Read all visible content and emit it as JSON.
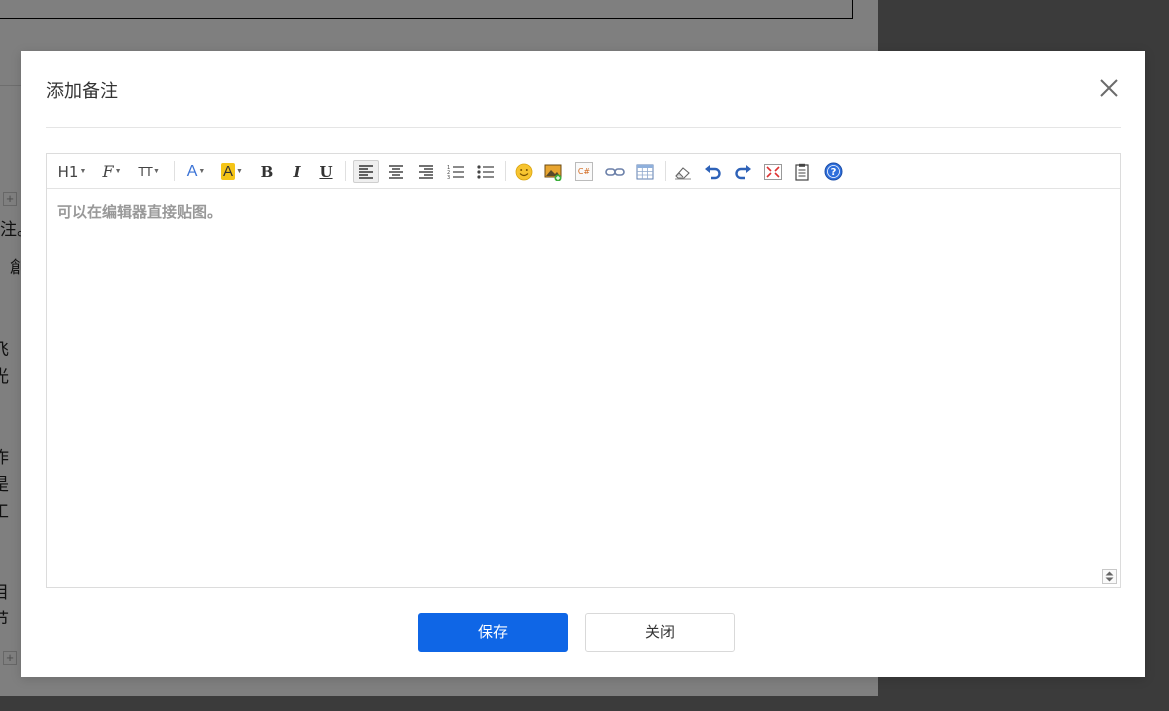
{
  "background": {
    "fragments": [
      "注。",
      "創",
      "飞",
      "光",
      "作",
      "是",
      "工",
      "目",
      "节"
    ]
  },
  "modal": {
    "title": "添加备注",
    "close_icon": "close-icon"
  },
  "editor": {
    "placeholder": "可以在编辑器直接贴图。",
    "toolbar": {
      "heading": "H1",
      "font_family": "F",
      "font_size": "TT",
      "font_color": "A",
      "highlight": "A",
      "bold": "B",
      "italic": "I",
      "underline": "U",
      "code": "C#",
      "icons": [
        "heading-icon",
        "font-family-icon",
        "font-size-icon",
        "font-color-icon",
        "highlight-icon",
        "bold-icon",
        "italic-icon",
        "underline-icon",
        "align-left-icon",
        "align-center-icon",
        "align-right-icon",
        "ordered-list-icon",
        "unordered-list-icon",
        "emoji-icon",
        "image-icon",
        "code-icon",
        "link-icon",
        "table-icon",
        "eraser-icon",
        "undo-icon",
        "redo-icon",
        "fullscreen-icon",
        "paste-icon",
        "help-icon"
      ],
      "active": "align-left"
    }
  },
  "buttons": {
    "save_label": "保存",
    "close_label": "关闭"
  },
  "colors": {
    "primary": "#0f66e6",
    "highlight": "#f5c518",
    "font_color": "#3b73d6",
    "help": "#2f6fdc"
  }
}
